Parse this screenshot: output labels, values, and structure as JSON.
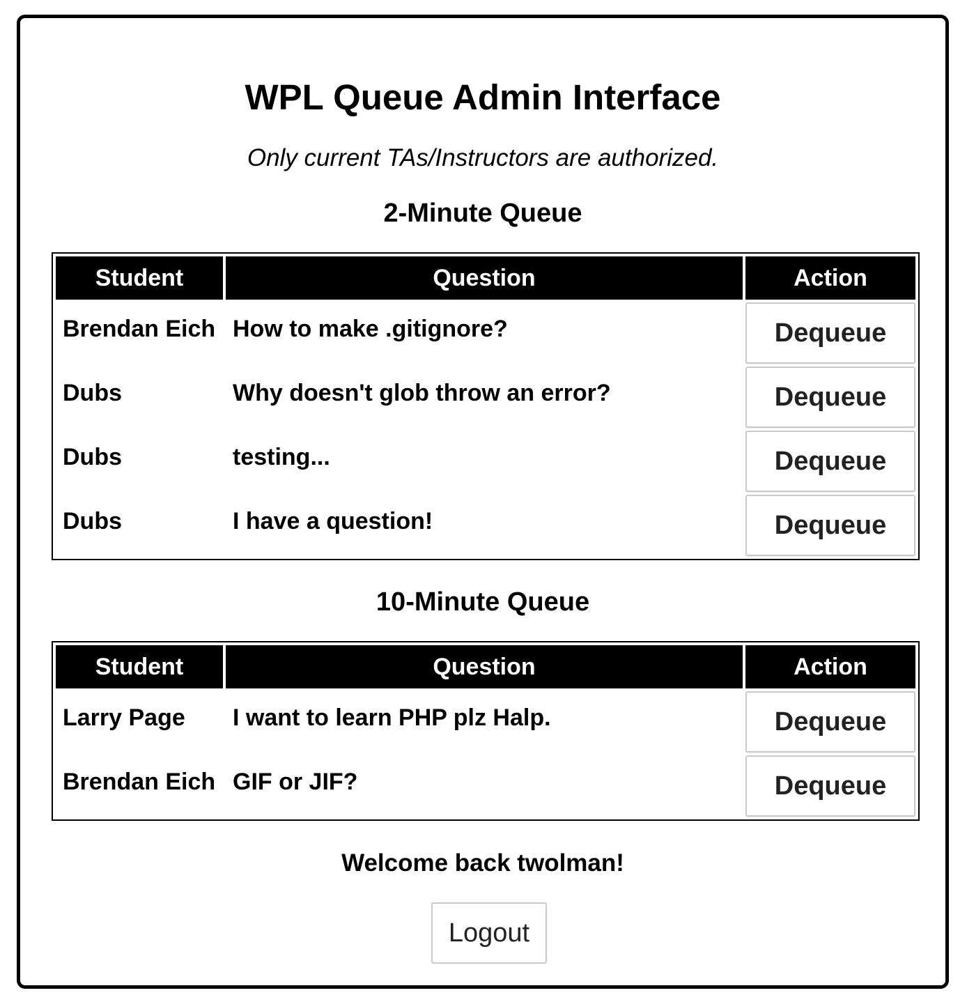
{
  "header": {
    "title": "WPL Queue Admin Interface",
    "subtitle": "Only current TAs/Instructors are authorized."
  },
  "columns": {
    "student": "Student",
    "question": "Question",
    "action": "Action"
  },
  "queue2": {
    "title": "2-Minute Queue",
    "rows": [
      {
        "student": "Brendan Eich",
        "question": "How to make .gitignore?",
        "action": "Dequeue"
      },
      {
        "student": "Dubs",
        "question": "Why doesn't glob throw an error?",
        "action": "Dequeue"
      },
      {
        "student": "Dubs",
        "question": "testing...",
        "action": "Dequeue"
      },
      {
        "student": "Dubs",
        "question": "I have a question!",
        "action": "Dequeue"
      }
    ]
  },
  "queue10": {
    "title": "10-Minute Queue",
    "rows": [
      {
        "student": "Larry Page",
        "question": "I want to learn PHP plz Halp.",
        "action": "Dequeue"
      },
      {
        "student": "Brendan Eich",
        "question": "GIF or JIF?",
        "action": "Dequeue"
      }
    ]
  },
  "footer": {
    "welcome": "Welcome back twolman!",
    "logout_label": "Logout"
  }
}
